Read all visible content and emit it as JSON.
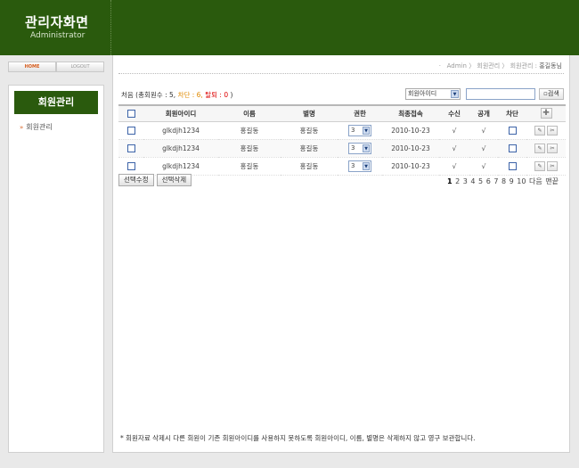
{
  "header": {
    "title_ko": "관리자화면",
    "title_en": "Administrator"
  },
  "topbtns": {
    "home": "HOME",
    "logout": "LOGOUT"
  },
  "sidebar": {
    "title": "회원관리",
    "items": [
      {
        "label": "회원관리"
      }
    ]
  },
  "breadcrumb": {
    "sep": "·",
    "p1": "Admin",
    "p2": "회원관리",
    "p3": "회원관리",
    "current": "홍길동님"
  },
  "count": {
    "prefix": "처음 (총회원수 : 5,",
    "blocked": "차단 : 6,",
    "left": "탈퇴 : 0",
    "suffix": ")"
  },
  "search": {
    "field": "회원아이디",
    "button": "검색"
  },
  "table": {
    "headers": [
      "회원아이디",
      "이름",
      "별명",
      "권한",
      "최종접속",
      "수신",
      "공개",
      "차단"
    ],
    "rows": [
      {
        "id": "glkdjh1234",
        "name": "홍길동",
        "nick": "홍길동",
        "level": "3",
        "last": "2010-10-23",
        "recv": "√",
        "open": "√"
      },
      {
        "id": "glkdjh1234",
        "name": "홍길동",
        "nick": "홍길동",
        "level": "3",
        "last": "2010-10-23",
        "recv": "√",
        "open": "√"
      },
      {
        "id": "glkdjh1234",
        "name": "홍길동",
        "nick": "홍길동",
        "level": "3",
        "last": "2010-10-23",
        "recv": "√",
        "open": "√"
      }
    ]
  },
  "actions": {
    "edit": "선택수정",
    "delete": "선택삭제"
  },
  "paging": {
    "pages": [
      "1",
      "2",
      "3",
      "4",
      "5",
      "6",
      "7",
      "8",
      "9",
      "10"
    ],
    "next": "다음",
    "last": "맨끝"
  },
  "note": "* 회원자료 삭제시 다른 회원이 기존 회원아이디를 사용하지 못하도록 회원아이디, 이름, 별명은 삭제하지 않고 영구 보관합니다."
}
